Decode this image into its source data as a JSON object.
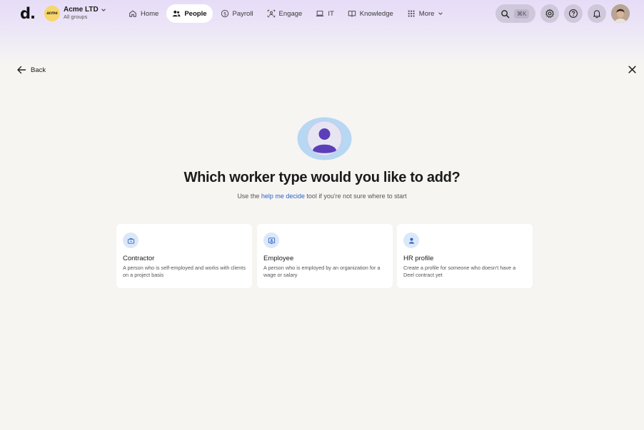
{
  "brand": {
    "logo_text": "d."
  },
  "org": {
    "logo_text": "acme",
    "name": "Acme LTD",
    "subtitle": "All groups"
  },
  "nav": {
    "items": [
      {
        "label": "Home",
        "icon": "home-icon",
        "active": false
      },
      {
        "label": "People",
        "icon": "people-icon",
        "active": true
      },
      {
        "label": "Payroll",
        "icon": "dollar-icon",
        "active": false
      },
      {
        "label": "Engage",
        "icon": "engage-icon",
        "active": false
      },
      {
        "label": "IT",
        "icon": "laptop-icon",
        "active": false
      },
      {
        "label": "Knowledge",
        "icon": "book-icon",
        "active": false
      },
      {
        "label": "More",
        "icon": "grid-icon",
        "active": false
      }
    ]
  },
  "toolbar": {
    "search_shortcut": "⌘K"
  },
  "page": {
    "back_label": "Back",
    "title": "Which worker type would you like to add?",
    "subtitle_prefix": "Use the ",
    "subtitle_link": "help me decide",
    "subtitle_suffix": " tool if you're not sure where to start"
  },
  "cards": [
    {
      "title": "Contractor",
      "description": "A person who is self-employed and works with clients on a project basis",
      "icon": "briefcase-icon"
    },
    {
      "title": "Employee",
      "description": "A person who is employed by an organization for a wage or salary",
      "icon": "id-card-icon"
    },
    {
      "title": "HR profile",
      "description": "Create a profile for someone who doesn't have a Deel contract yet",
      "icon": "user-icon"
    }
  ],
  "colors": {
    "accent": "#2a62c9",
    "header_tint": "#e6dcf7",
    "icon_bg": "#dce8f8",
    "hero_purple": "#5b3fb8"
  }
}
